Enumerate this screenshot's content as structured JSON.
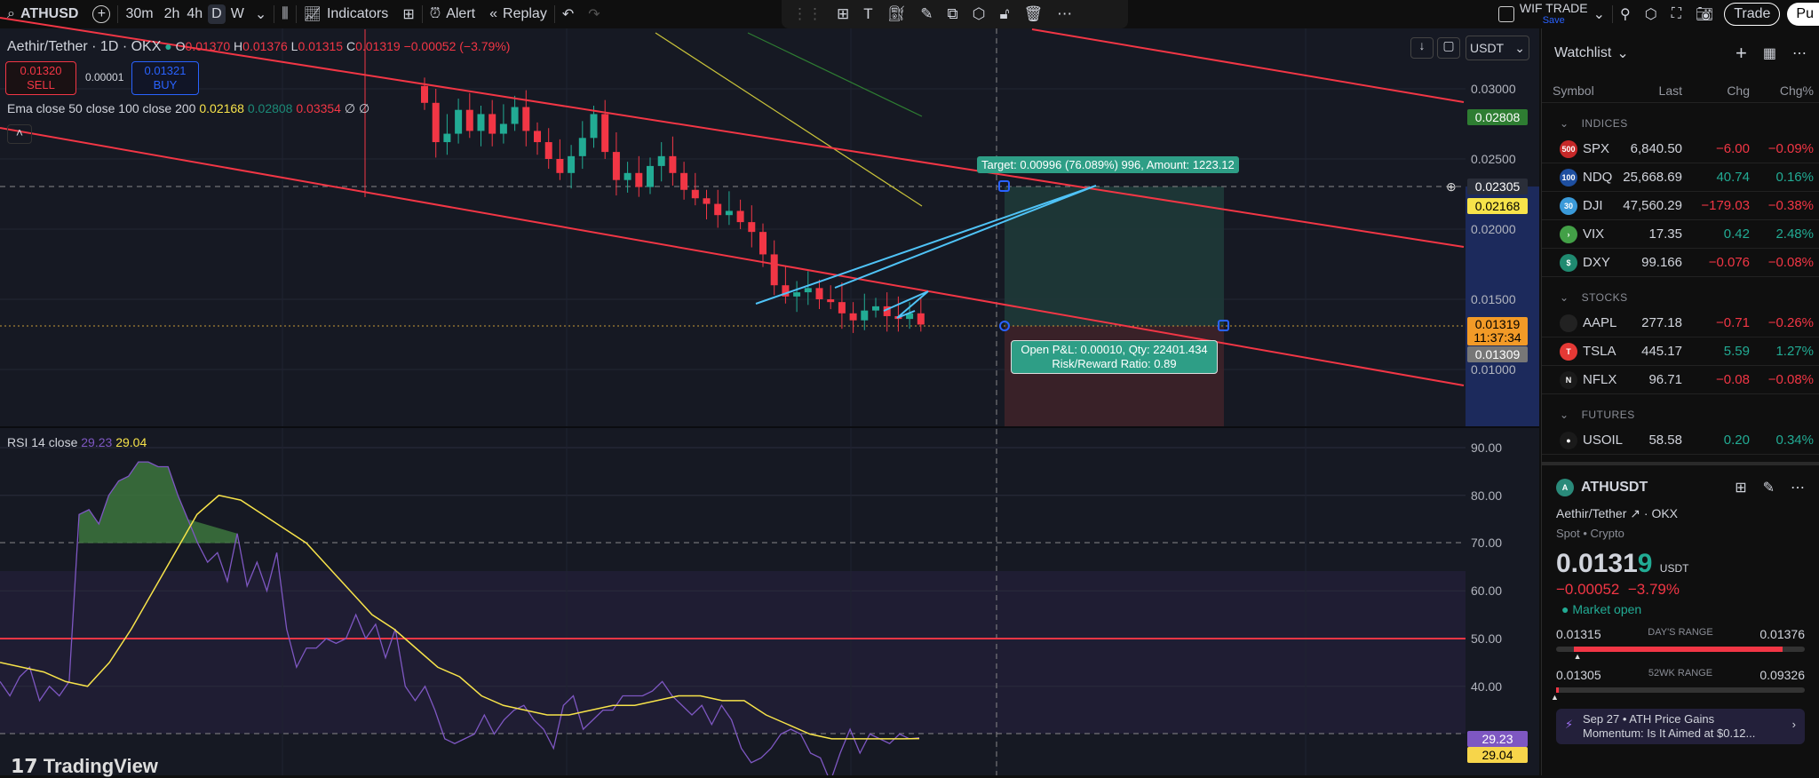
{
  "toolbar": {
    "symbol": "ATHUSD",
    "intervals": [
      "30m",
      "2h",
      "4h",
      "D",
      "W"
    ],
    "selected_interval": "D",
    "indicators": "Indicators",
    "alert": "Alert",
    "replay": "Replay",
    "layout_name": "WIF TRADE",
    "layout_save": "Save",
    "trade": "Trade",
    "publish": "Pu"
  },
  "legend": {
    "title": "Aethir/Tether · 1D · OKX",
    "o_label": "O",
    "o": "0.01370",
    "h_label": "H",
    "h": "0.01376",
    "l_label": "L",
    "l": "0.01315",
    "c_label": "C",
    "c": "0.01319",
    "change": "−0.00052 (−3.79%)",
    "sell_price": "0.01320",
    "sell": "SELL",
    "spread": "0.00001",
    "buy_price": "0.01321",
    "buy": "BUY",
    "ema_label": "Ema close 50 close 100 close 200",
    "ema50": "0.02168",
    "ema100": "0.02808",
    "ema200": "0.03354",
    "ema_extra": "∅ ∅"
  },
  "price_axis": {
    "currency": "USDT",
    "ticks": [
      "0.03000",
      "0.02500",
      "0.02000",
      "0.01500",
      "0.01000"
    ],
    "tags": {
      "ema100": "0.02808",
      "crosshair": "0.02305",
      "ema50": "0.02168",
      "last": "0.01319",
      "countdown": "11:37:34",
      "stop": "0.01309"
    }
  },
  "position": {
    "target_label": "Target: 0.00996 (76.089%) 996, Amount: 1223.12",
    "pnl_label": "Open P&L: 0.00010, Qty: 22401.434",
    "rr_label": "Risk/Reward Ratio: 0.89"
  },
  "colors": {
    "up": "#22ab94",
    "down": "#f23645",
    "rsi": "#7e57c2",
    "rsi_ma": "#f7e34a",
    "ema50": "#c8c23a",
    "ema100": "#2e7d32",
    "trend": "#f23645",
    "cyan": "#4fc3f7"
  },
  "candles": {
    "open0": 0.0302,
    "closes": [
      0.029,
      0.0262,
      0.0268,
      0.0285,
      0.027,
      0.0282,
      0.0268,
      0.0275,
      0.0287,
      0.027,
      0.0262,
      0.025,
      0.024,
      0.0252,
      0.0265,
      0.0282,
      0.0255,
      0.0235,
      0.024,
      0.023,
      0.0245,
      0.0252,
      0.024,
      0.0228,
      0.0222,
      0.0218,
      0.021,
      0.0213,
      0.0205,
      0.0198,
      0.0182,
      0.016,
      0.0152,
      0.0155,
      0.0158,
      0.015,
      0.0148,
      0.014,
      0.0135,
      0.0142,
      0.0145,
      0.0138,
      0.0136,
      0.014,
      0.0132
    ]
  },
  "rsi": {
    "label": "RSI 14 close",
    "value": "29.23",
    "ma_value": "29.04",
    "ticks": [
      "90.00",
      "80.00",
      "70.00",
      "60.00",
      "50.00",
      "40.00"
    ],
    "values": [
      41,
      38,
      42,
      44,
      37,
      40,
      38,
      41,
      76,
      77,
      74,
      80,
      83,
      84,
      87,
      87,
      86,
      86,
      80,
      75,
      70,
      66,
      68,
      62,
      72,
      61,
      66,
      60,
      68,
      52,
      44,
      48,
      48,
      50,
      49,
      50,
      55,
      50,
      53,
      46,
      52,
      40,
      37,
      40,
      35,
      29,
      28,
      29,
      30,
      34,
      30,
      33,
      35,
      36,
      33,
      31,
      27,
      36,
      38,
      31,
      33,
      35,
      35,
      38,
      38,
      38,
      39,
      41,
      38,
      36,
      34,
      36,
      32,
      36,
      33,
      27,
      24,
      25,
      27,
      30,
      31,
      30,
      26,
      25,
      20,
      26,
      31,
      26,
      30,
      29,
      28,
      30,
      29,
      29.23
    ],
    "ma": [
      45,
      44,
      43,
      41,
      40,
      45,
      52,
      60,
      68,
      76,
      80,
      79,
      76,
      73,
      70,
      65,
      60,
      55,
      52,
      48,
      44,
      42,
      38,
      36,
      35,
      34,
      34,
      35,
      36,
      36,
      37,
      38,
      38,
      37,
      37,
      34,
      32,
      30,
      29,
      29,
      29,
      29,
      29.04
    ]
  },
  "watchlist": {
    "title": "Watchlist",
    "cols": [
      "Symbol",
      "Last",
      "Chg",
      "Chg%"
    ],
    "sections": [
      {
        "name": "INDICES",
        "rows": [
          {
            "sym": "SPX",
            "badge": "500",
            "bc": "#c62828",
            "last": "6,840.50",
            "chg": "−6.00",
            "pct": "−0.09%",
            "dir": "down"
          },
          {
            "sym": "NDQ",
            "badge": "100",
            "bc": "#1e4fa0",
            "last": "25,668.69",
            "chg": "40.74",
            "pct": "0.16%",
            "dir": "up"
          },
          {
            "sym": "DJI",
            "badge": "30",
            "bc": "#3a9ad9",
            "last": "47,560.29",
            "chg": "−179.03",
            "pct": "−0.38%",
            "dir": "down"
          },
          {
            "sym": "VIX",
            "badge": "›",
            "bc": "#43a047",
            "last": "17.35",
            "chg": "0.42",
            "pct": "2.48%",
            "dir": "up"
          },
          {
            "sym": "DXY",
            "badge": "$",
            "bc": "#1f8a70",
            "last": "99.166",
            "chg": "−0.076",
            "pct": "−0.08%",
            "dir": "down"
          }
        ]
      },
      {
        "name": "STOCKS",
        "rows": [
          {
            "sym": "AAPL",
            "badge": "",
            "bc": "#222",
            "last": "277.18",
            "chg": "−0.71",
            "pct": "−0.26%",
            "dir": "down"
          },
          {
            "sym": "TSLA",
            "badge": "T",
            "bc": "#e53935",
            "last": "445.17",
            "chg": "5.59",
            "pct": "1.27%",
            "dir": "up"
          },
          {
            "sym": "NFLX",
            "badge": "N",
            "bc": "#1a1a1a",
            "last": "96.71",
            "chg": "−0.08",
            "pct": "−0.08%",
            "dir": "down"
          }
        ]
      },
      {
        "name": "FUTURES",
        "rows": [
          {
            "sym": "USOIL",
            "badge": "●",
            "bc": "#1a1a1a",
            "last": "58.58",
            "chg": "0.20",
            "pct": "0.34%",
            "dir": "up"
          }
        ]
      }
    ]
  },
  "details": {
    "symbol": "ATHUSDT",
    "name": "Aethir/Tether",
    "exchange": "· OKX",
    "type": "Spot • Crypto",
    "price_main": "0.0131",
    "price_last_digit": "9",
    "currency": "USDT",
    "change": "−0.00052",
    "change_pct": "−3.79%",
    "status": "Market open",
    "day_low": "0.01315",
    "day_label": "DAY'S RANGE",
    "day_high": "0.01376",
    "day_position": 0.07,
    "wk_low": "0.01305",
    "wk_label": "52WK RANGE",
    "wk_high": "0.09326",
    "wk_position": 0.002,
    "news_date": "Sep 27",
    "news_title": "ATH Price Gains",
    "news_body": "Momentum: Is It Aimed at $0.12..."
  },
  "branding": {
    "logo": "TradingView"
  }
}
